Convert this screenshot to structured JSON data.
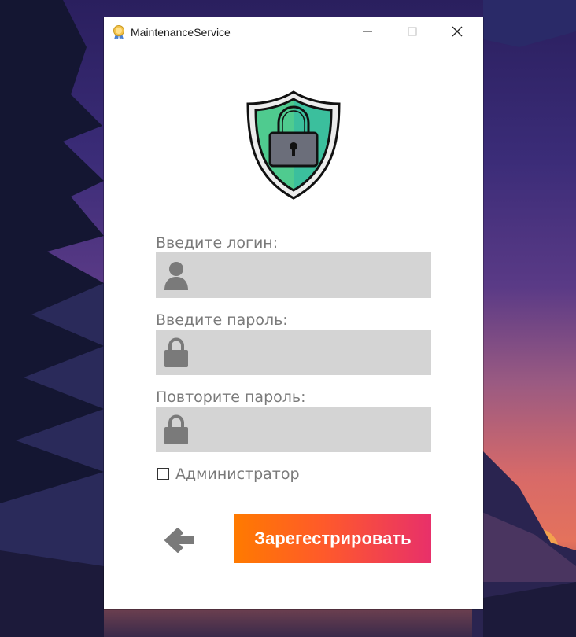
{
  "window": {
    "title": "MaintenanceService",
    "app_icon": "award-ribbon-icon",
    "controls": [
      "minimize-icon",
      "maximize-icon",
      "close-icon"
    ]
  },
  "header_icon": "shield-lock-icon",
  "form": {
    "login_label": "Введите логин:",
    "login_value": "",
    "login_icon": "user-icon",
    "password_label": "Введите пароль:",
    "password_value": "",
    "password_icon": "lock-icon",
    "repeat_password_label": "Повторите пароль:",
    "repeat_password_value": "",
    "repeat_password_icon": "lock-icon",
    "admin_checkbox_label": "Администратор",
    "admin_checked": false
  },
  "actions": {
    "back_icon": "arrow-left-icon",
    "register_label": "Зарегестрировать"
  },
  "colors": {
    "field_bg": "#d4d4d4",
    "label_text": "#7a7a7a",
    "button_gradient_start": "#ff7a00",
    "button_gradient_end": "#e8306a",
    "shield_green": "#4fcb8f",
    "shield_teal": "#3bbf9d"
  }
}
